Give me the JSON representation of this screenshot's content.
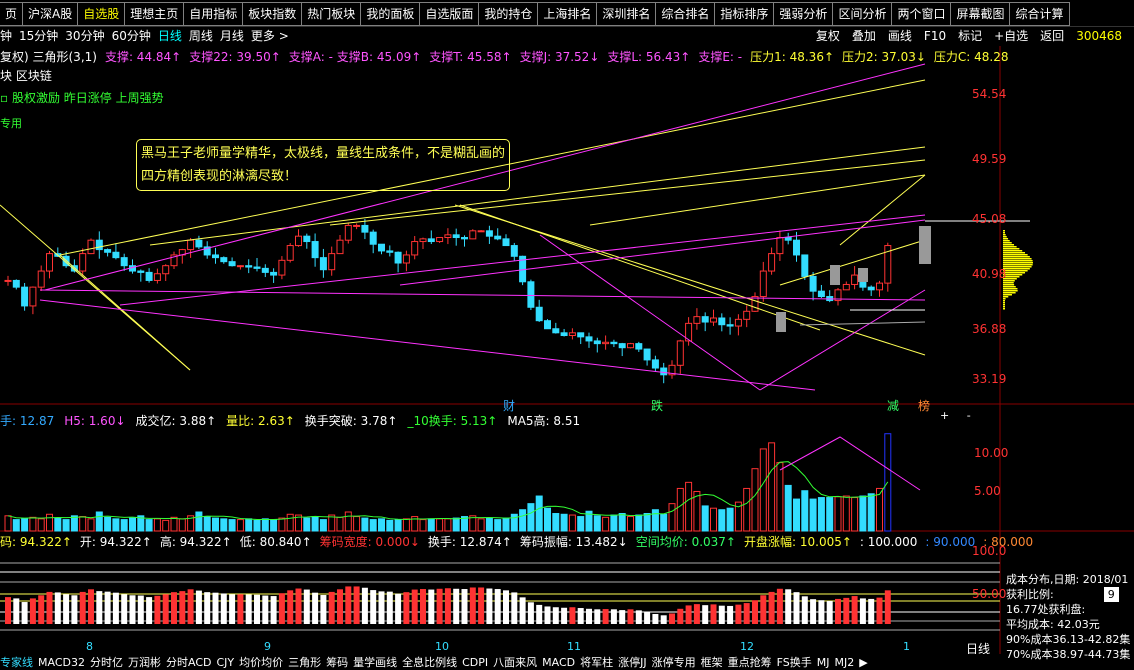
{
  "top_tabs": [
    "页",
    "沪深A股",
    "自选股",
    "理想主页",
    "自用指标",
    "板块指数",
    "热门板块",
    "我的面板",
    "自选版面",
    "我的持仓",
    "上海排名",
    "深圳排名",
    "综合排名",
    "指标排序",
    "强弱分析",
    "区间分析",
    "两个窗口",
    "屏幕截图",
    "综合计算"
  ],
  "periods": [
    "钟",
    "15分钟",
    "30分钟",
    "60分钟",
    "日线",
    "周线",
    "月线",
    "更多 >"
  ],
  "toolbar_right": [
    "复权",
    "叠加",
    "画线",
    "F10",
    "标记",
    "+自选",
    "返回"
  ],
  "stock_code": "300468",
  "indicator_line": [
    {
      "text": "复权)  三角形(3,1)",
      "color": "#ffffff"
    },
    {
      "text": "支撑: 44.84↑",
      "color": "#ff55ff"
    },
    {
      "text": "支撑22: 39.50↑",
      "color": "#ff55ff"
    },
    {
      "text": "支撑A: - 支撑B: 45.09↑",
      "color": "#ff55ff"
    },
    {
      "text": "支撑T: 45.58↑",
      "color": "#ff55ff"
    },
    {
      "text": "支撑J: 37.52↓",
      "color": "#ff55ff"
    },
    {
      "text": "支撑L: 56.43↑",
      "color": "#ff55ff"
    },
    {
      "text": "支撑E: -",
      "color": "#ff55ff"
    },
    {
      "text": "压力1: 48.36↑",
      "color": "#ffff33"
    },
    {
      "text": "压力2: 37.03↓",
      "color": "#ffff33"
    },
    {
      "text": "压力C: 48.28",
      "color": "#ffff33"
    }
  ],
  "block_line": "块  区块链",
  "concept_line": "▫ 股权激励  昨日涨停  上周强势",
  "zhuanyong": "专用",
  "annotation": [
    "黑马王子老师量学精华，太极线，量线生成条件，不是糊乱画的",
    "四方精创表现的淋漓尽致！"
  ],
  "price_axis": [
    "54.54",
    "49.59",
    "45.08",
    "40.98",
    "36.88",
    "33.19"
  ],
  "event_marks": [
    {
      "text": "财",
      "color": "#33aaff"
    },
    {
      "text": "跌",
      "color": "#33ff66"
    },
    {
      "text": "减",
      "color": "#33ff66"
    },
    {
      "text": "榜",
      "color": "#ff8833"
    }
  ],
  "volume_line": [
    {
      "text": "手: 12.87",
      "color": "#33aaff"
    },
    {
      "text": "H5: 1.60↓",
      "color": "#ff55ff"
    },
    {
      "text": "成交亿: 3.88↑",
      "color": "#ffffff"
    },
    {
      "text": "量比: 2.63↑",
      "color": "#ffff33"
    },
    {
      "text": "换手突破: 3.78↑",
      "color": "#ffffff"
    },
    {
      "text": "_10换手: 5.13↑",
      "color": "#33ff33"
    },
    {
      "text": "MA5高: 8.51",
      "color": "#ffffff"
    }
  ],
  "volume_axis": [
    "10.00",
    "5.00"
  ],
  "info_line": [
    {
      "text": "码: 94.322↑",
      "color": "#ffff33"
    },
    {
      "text": "开: 94.322↑",
      "color": "#ffffff"
    },
    {
      "text": "高: 94.322↑",
      "color": "#ffffff"
    },
    {
      "text": "低: 80.840↑",
      "color": "#ffffff"
    },
    {
      "text": "筹码宽度: 0.000↓",
      "color": "#ff3333"
    },
    {
      "text": "换手: 12.874↑",
      "color": "#ffffff"
    },
    {
      "text": "筹码振幅: 13.482↓",
      "color": "#ffffff"
    },
    {
      "text": "空间均价: 0.037↑",
      "color": "#33ff66"
    },
    {
      "text": "开盘涨幅: 10.005↑",
      "color": "#ffff33"
    },
    {
      "text": ": 100.000",
      "color": "#ffffff"
    },
    {
      "text": ": 90.000",
      "color": "#3388ff"
    },
    {
      "text": ": 80.000",
      "color": "#ff8833"
    }
  ],
  "bottom_axis": [
    "100.0",
    "50.00"
  ],
  "months": [
    "8",
    "9",
    "10",
    "11",
    "12",
    "1"
  ],
  "side_panel": [
    "成本分布,日期: 2018/01",
    "获利比例:",
    "16.77处获利盘:",
    "平均成本: 42.03元",
    "90%成本36.13-42.82集",
    "70%成本38.97-44.73集"
  ],
  "side_input": "9",
  "side_btns": [
    "日线",
    "+",
    "-"
  ],
  "bottom_menu": [
    "专家线",
    "MACD32",
    "分时亿",
    "万润彬",
    "分时ACD",
    "CJY",
    "均价均价",
    "三角形",
    "筹码",
    "量学画线",
    "全息比例线",
    "CDPI",
    "八面来风",
    "MACD",
    "将军柱",
    "涨停JJ",
    "涨停专用",
    "框架",
    "重点抢筹",
    "FS换手",
    "MJ",
    "MJ2",
    "▶"
  ],
  "colors": {
    "up": "#ff3333",
    "down": "#33ddff",
    "axis_red": "#ff3333",
    "magenta": "#ff33ff",
    "yellow": "#ffff55",
    "gray": "#aaaaaa"
  }
}
